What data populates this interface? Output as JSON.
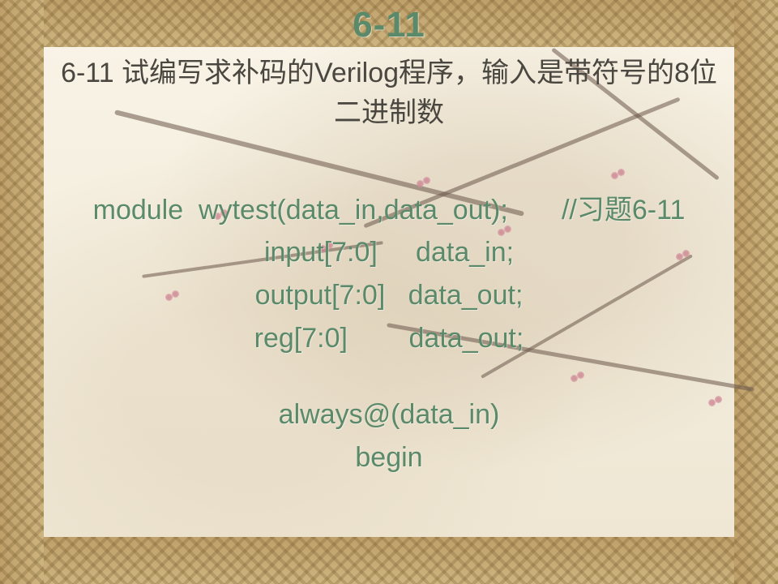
{
  "slide": {
    "number": "6-11",
    "prompt": "6-11  试编写求补码的Verilog程序，输入是带符号的8位二进制数",
    "code": {
      "l1": "module  wytest(data_in,data_out);       //习题6-11",
      "l2": "input[7:0]     data_in;",
      "l3": "output[7:0]   data_out;",
      "l4": "reg[7:0]        data_out;",
      "l5": "always@(data_in)",
      "l6": "begin"
    }
  }
}
